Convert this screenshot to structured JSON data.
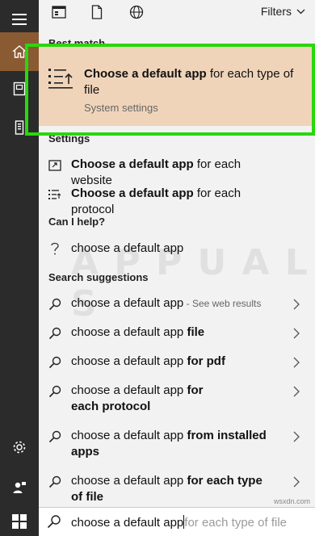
{
  "topbar": {
    "filters_label": "Filters"
  },
  "sections": {
    "best_match": "Best match",
    "settings": "Settings",
    "can_i_help": "Can I help?",
    "search_suggestions": "Search suggestions"
  },
  "best_match": {
    "title_bold": "Choose a default app",
    "title_rest": " for each type of file",
    "subtitle": "System settings"
  },
  "settings_items": [
    {
      "bold": "Choose a default app",
      "rest": " for each website"
    },
    {
      "bold": "Choose a default app",
      "rest": " for each protocol"
    }
  ],
  "help_item": {
    "text": "choose a default app"
  },
  "suggestions": [
    {
      "plain": "choose a default app",
      "bold": "",
      "web": " - See web results"
    },
    {
      "plain": "choose a default app ",
      "bold": "file",
      "web": ""
    },
    {
      "plain": "choose a default app ",
      "bold": "for pdf",
      "web": ""
    },
    {
      "plain": "choose a default app ",
      "bold": "for each protocol",
      "web": ""
    },
    {
      "plain": "choose a default app ",
      "bold": "from installed apps",
      "web": ""
    },
    {
      "plain": "choose a default app ",
      "bold": "for each type of file",
      "web": ""
    }
  ],
  "search": {
    "typed": "choose a default app",
    "ghost": "for each type of file"
  },
  "watermark": "APPUALS",
  "footer_tag": "wsxdn.com",
  "colors": {
    "rail": "#2b2b2b",
    "active_rail": "#8a5a32",
    "best_match_bg": "#f0d4ba",
    "highlight_border": "#29d70d"
  }
}
